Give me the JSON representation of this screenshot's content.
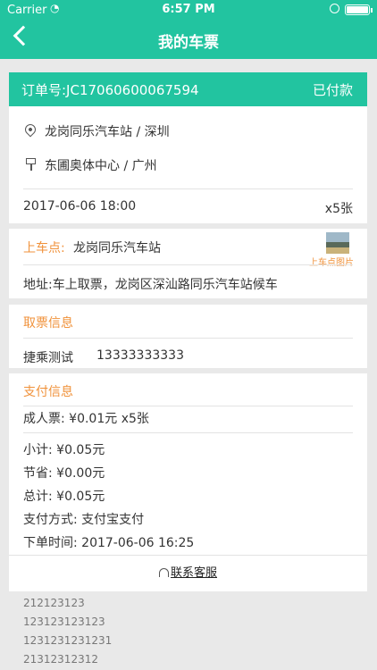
{
  "status_bar": {
    "carrier": "Carrier",
    "time": "6:57 PM"
  },
  "nav": {
    "title": "我的车票"
  },
  "order": {
    "number": "订单号:JC17060600067594",
    "status": "已付款"
  },
  "route": {
    "from": "龙岗同乐汽车站 / 深圳",
    "to": "东圃奥体中心 / 广州",
    "datetime": "2017-06-06 18:00",
    "count": "x5张"
  },
  "boarding": {
    "label": "上车点:",
    "station": "龙岗同乐汽车站",
    "photo_label": "上车点图片",
    "address": "地址:车上取票，龙岗区深汕路同乐汽车站候车"
  },
  "ticket_info": {
    "title": "取票信息",
    "name": "捷乘测试",
    "phone": "13333333333"
  },
  "payment": {
    "title": "支付信息",
    "adult": "成人票: ¥0.01元 x5张",
    "subtotal": "小计: ¥0.05元",
    "saving": "节省: ¥0.00元",
    "total": "总计: ¥0.05元",
    "method": "支付方式:  支付宝支付",
    "order_time": "下单时间:  2017-06-06 16:25"
  },
  "service": {
    "label": "联系客服"
  },
  "footer": {
    "lines": [
      "212123123",
      "123123123123",
      "1231231231231",
      "21312312312"
    ]
  },
  "colors": {
    "accent": "#22c4a0",
    "orange": "#f0923b"
  }
}
